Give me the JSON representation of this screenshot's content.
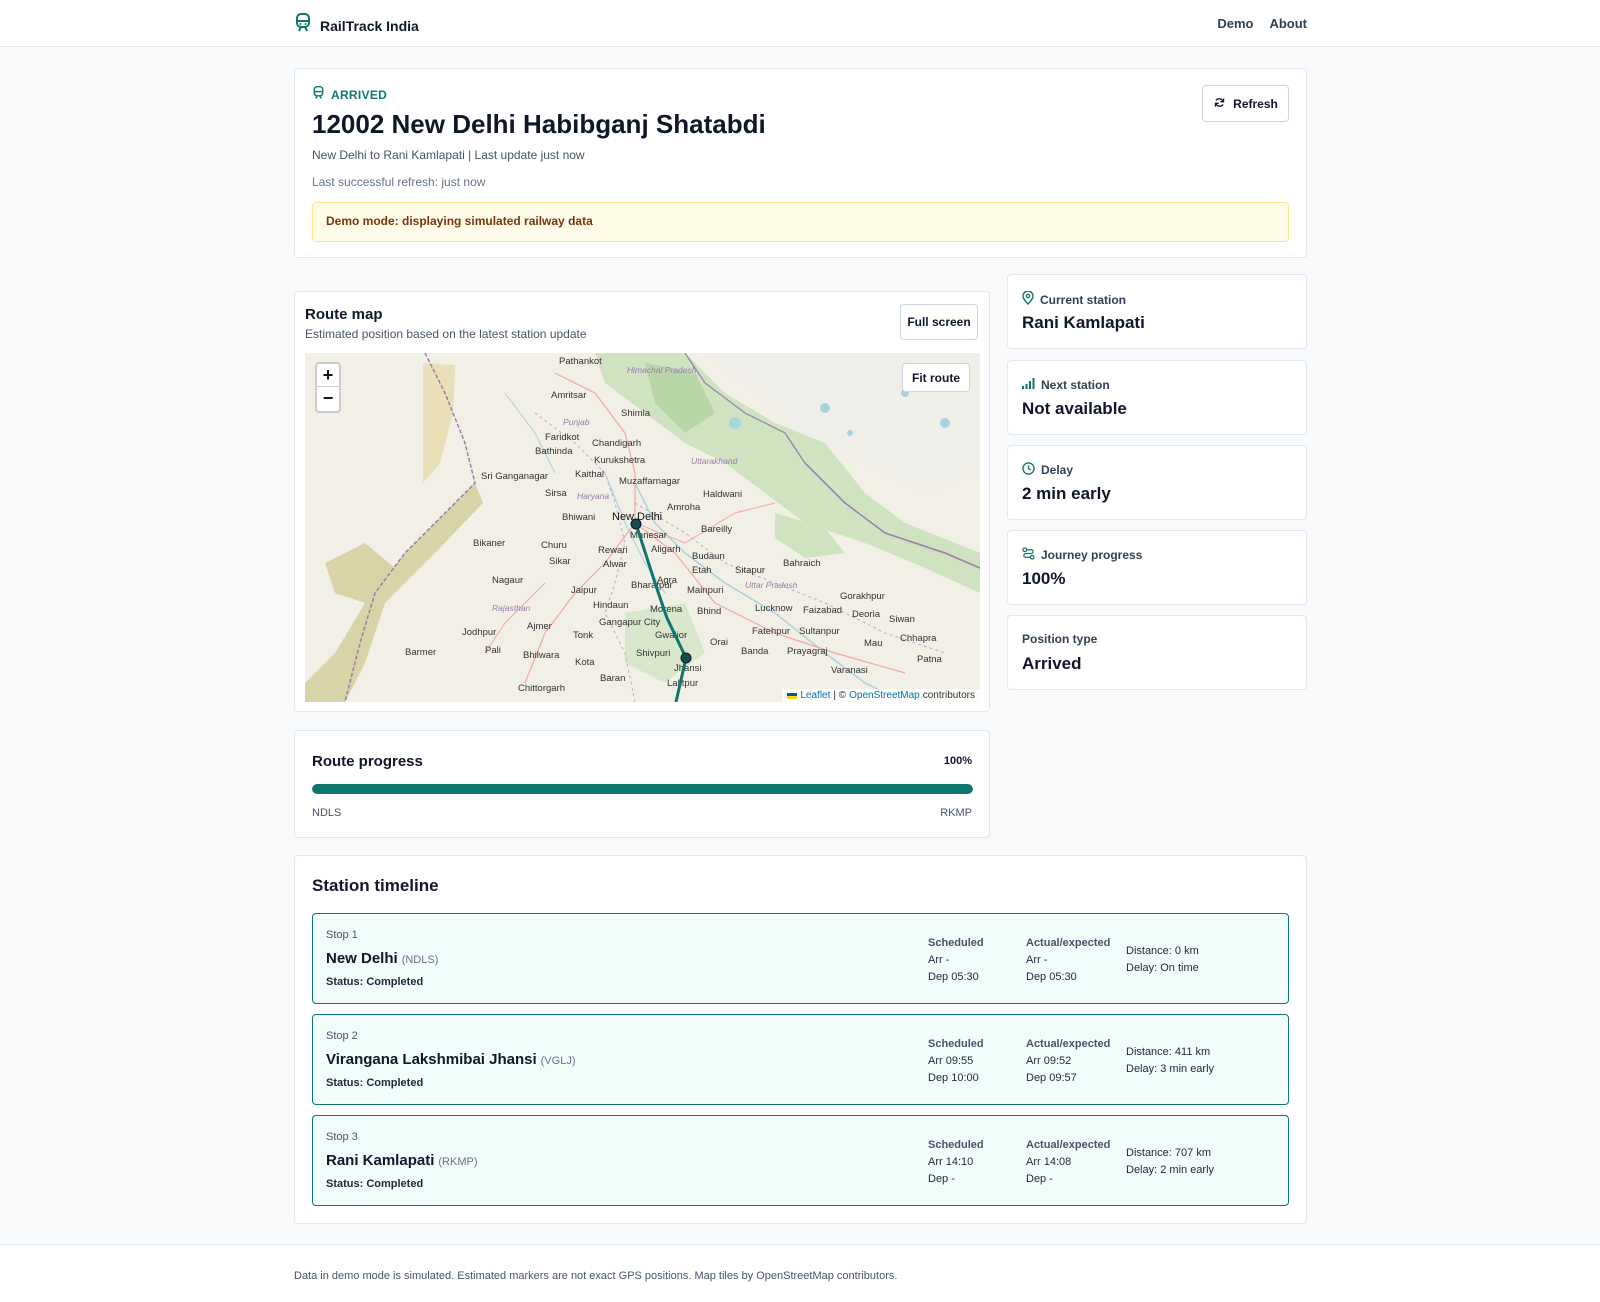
{
  "nav": {
    "brand": "RailTrack India",
    "links": [
      "Demo",
      "About"
    ]
  },
  "header": {
    "status": "ARRIVED",
    "title": "12002 New Delhi Habibganj Shatabdi",
    "subtitle": "New Delhi to Rani Kamlapati | Last update just now",
    "last_refresh": "Last successful refresh: just now",
    "demo_banner": "Demo mode: displaying simulated railway data",
    "refresh_label": "Refresh"
  },
  "map": {
    "title": "Route map",
    "subtitle": "Estimated position based on the latest station update",
    "fullscreen_label": "Full screen",
    "fit_label": "Fit route",
    "zoom_in": "+",
    "zoom_out": "−",
    "attribution_leaflet": "Leaflet",
    "attribution_sep": "| ©",
    "attribution_osm": "OpenStreetMap",
    "attribution_tail": "contributors",
    "place_labels": [
      "Pathankot",
      "Amritsar",
      "Shimla",
      "Chandigarh",
      "Kurukshetra",
      "Faridkot",
      "Bathinda",
      "Sri Ganganagar",
      "Kaithal",
      "Muzaffarnagar",
      "Sirsa",
      "Haldwani",
      "Amroha",
      "Bhiwani",
      "New Delhi",
      "Manesar",
      "Rewari",
      "Aligarh",
      "Bareilly",
      "Churu",
      "Budaun",
      "Bikaner",
      "Sikar",
      "Alwar",
      "Etah",
      "Sitapur",
      "Nagaur",
      "Jaipur",
      "Bharatpur",
      "Agra",
      "Mainpuri",
      "Bahraich",
      "Gorakhpur",
      "Hindaun",
      "Morena",
      "Bhind",
      "Lucknow",
      "Faizabad",
      "Deoria",
      "Siwan",
      "Jodhpur",
      "Ajmer",
      "Gangapur City",
      "Tonk",
      "Gwalior",
      "Fatehpur",
      "Sultanpur",
      "Barmer",
      "Pali",
      "Bhilwara",
      "Kota",
      "Shivpuri",
      "Orai",
      "Banda",
      "Prayagraj",
      "Mau",
      "Chhapra",
      "Patna",
      "Jhansi",
      "Baran",
      "Varanasi",
      "Chittorgarh",
      "Lalitpur"
    ],
    "region_labels": [
      "Himachal Pradesh",
      "Punjab",
      "Uttarakhand",
      "Haryana",
      "Uttar Pradesh",
      "Rajasthan"
    ]
  },
  "stats": [
    {
      "icon": "map-pin-icon",
      "label": "Current station",
      "value": "Rani Kamlapati"
    },
    {
      "icon": "signal-bars-icon",
      "label": "Next station",
      "value": "Not available"
    },
    {
      "icon": "clock-icon",
      "label": "Delay",
      "value": "2 min early"
    },
    {
      "icon": "route-icon",
      "label": "Journey progress",
      "value": "100%"
    },
    {
      "icon": "none",
      "label": "Position type",
      "value": "Arrived"
    }
  ],
  "progress": {
    "title": "Route progress",
    "percent_label": "100%",
    "value": 1.0,
    "from": "NDLS",
    "to": "RKMP"
  },
  "timeline": {
    "title": "Station timeline",
    "stops": [
      {
        "num": "Stop 1",
        "name": "New Delhi",
        "code": "(NDLS)",
        "status": "Status: Completed",
        "sched_h": "Scheduled",
        "sched_arr": "Arr -",
        "sched_dep": "Dep 05:30",
        "act_h": "Actual/expected",
        "act_arr": "Arr -",
        "act_dep": "Dep 05:30",
        "distance": "Distance: 0 km",
        "delay": "Delay: On time"
      },
      {
        "num": "Stop 2",
        "name": "Virangana Lakshmibai Jhansi",
        "code": "(VGLJ)",
        "status": "Status: Completed",
        "sched_h": "Scheduled",
        "sched_arr": "Arr 09:55",
        "sched_dep": "Dep 10:00",
        "act_h": "Actual/expected",
        "act_arr": "Arr 09:52",
        "act_dep": "Dep 09:57",
        "distance": "Distance: 411 km",
        "delay": "Delay: 3 min early"
      },
      {
        "num": "Stop 3",
        "name": "Rani Kamlapati",
        "code": "(RKMP)",
        "status": "Status: Completed",
        "sched_h": "Scheduled",
        "sched_arr": "Arr 14:10",
        "sched_dep": "Dep -",
        "act_h": "Actual/expected",
        "act_arr": "Arr 14:08",
        "act_dep": "Dep -",
        "distance": "Distance: 707 km",
        "delay": "Delay: 2 min early"
      }
    ]
  },
  "footer": "Data in demo mode is simulated. Estimated markers are not exact GPS positions. Map tiles by OpenStreetMap contributors.",
  "colors": {
    "accent": "#0f766e",
    "banner_bg": "#fefce8",
    "banner_text": "#78350f",
    "stop_bg": "#f0fdfa"
  }
}
